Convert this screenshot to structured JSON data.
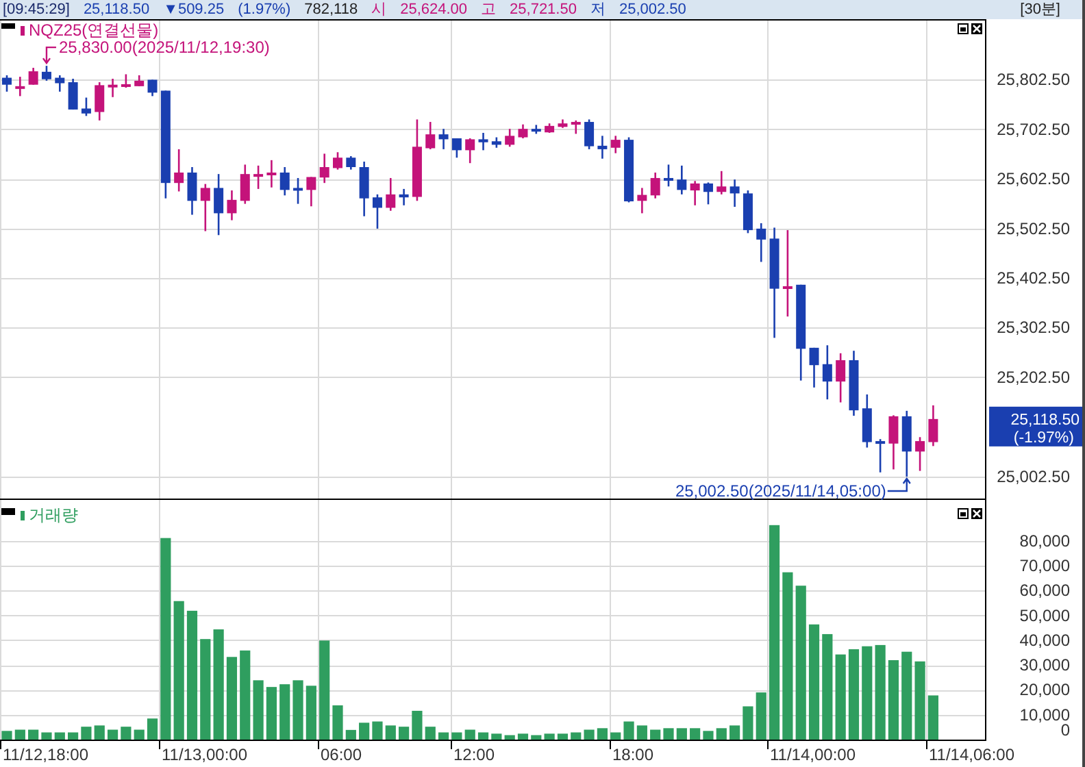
{
  "header": {
    "items": [
      {
        "text": "[09:45:29]",
        "kind": "time"
      },
      {
        "text": "25,118.50",
        "kind": "down"
      },
      {
        "text": "▼509.25",
        "kind": "down"
      },
      {
        "text": "(1.97%)",
        "kind": "down"
      },
      {
        "text": "782,118",
        "kind": "plain"
      },
      {
        "text": "시",
        "kind": "up"
      },
      {
        "text": "25,624.00",
        "kind": "up"
      },
      {
        "text": "고",
        "kind": "up"
      },
      {
        "text": "25,721.50",
        "kind": "up"
      },
      {
        "text": "저",
        "kind": "down"
      },
      {
        "text": "25,002.50",
        "kind": "down"
      }
    ],
    "interval": "[30분]"
  },
  "price_panel": {
    "legend": "NQZ25(연결선물)",
    "last_price": "25,118.50",
    "last_change": "(-1.97%)",
    "high_marker": "25,830.00(2025/11/12,19:30)",
    "low_marker": "25,002.50(2025/11/14,05:00)",
    "chart_data": {
      "type": "candlestick",
      "ylim": [
        24955.5,
        25924
      ],
      "yticks": [
        {
          "value": 25802.5,
          "label": "25,802.50"
        },
        {
          "value": 25702.5,
          "label": "25,702.50"
        },
        {
          "value": 25602.5,
          "label": "25,602.50"
        },
        {
          "value": 25502.5,
          "label": "25,502.50"
        },
        {
          "value": 25402.5,
          "label": "25,402.50"
        },
        {
          "value": 25302.5,
          "label": "25,302.50"
        },
        {
          "value": 25202.5,
          "label": "25,202.50"
        },
        {
          "value": 25002.5,
          "label": "25,002.50"
        }
      ],
      "grid": true,
      "ohlc": [
        [
          25806,
          25811,
          25778,
          25792
        ],
        [
          25786,
          25808,
          25769,
          25789
        ],
        [
          25792,
          25826,
          25792,
          25819
        ],
        [
          25818,
          25830,
          25800,
          25803
        ],
        [
          25806,
          25811,
          25778,
          25795
        ],
        [
          25797,
          25804,
          25742,
          25742
        ],
        [
          25744,
          25766,
          25729,
          25734
        ],
        [
          25737,
          25797,
          25720,
          25791
        ],
        [
          25791,
          25804,
          25767,
          25792
        ],
        [
          25789,
          25813,
          25786,
          25793
        ],
        [
          25789,
          25811,
          25789,
          25800
        ],
        [
          25802,
          25802,
          25769,
          25776
        ],
        [
          25780,
          25780,
          25563,
          25594
        ],
        [
          25594,
          25662,
          25577,
          25615
        ],
        [
          25615,
          25626,
          25530,
          25558
        ],
        [
          25558,
          25592,
          25497,
          25584
        ],
        [
          25584,
          25612,
          25489,
          25533
        ],
        [
          25533,
          25579,
          25519,
          25560
        ],
        [
          25558,
          25631,
          25552,
          25612
        ],
        [
          25611,
          25629,
          25582,
          25612
        ],
        [
          25610,
          25640,
          25585,
          25615
        ],
        [
          25615,
          25626,
          25569,
          25580
        ],
        [
          25584,
          25604,
          25552,
          25580
        ],
        [
          25580,
          25606,
          25547,
          25606
        ],
        [
          25605,
          25653,
          25594,
          25626
        ],
        [
          25624,
          25656,
          25621,
          25645
        ],
        [
          25645,
          25648,
          25621,
          25626
        ],
        [
          25626,
          25637,
          25527,
          25563
        ],
        [
          25565,
          25571,
          25502,
          25544
        ],
        [
          25544,
          25604,
          25538,
          25571
        ],
        [
          25571,
          25582,
          25549,
          25565
        ],
        [
          25566,
          25722,
          25558,
          25667
        ],
        [
          25664,
          25717,
          25662,
          25692
        ],
        [
          25692,
          25703,
          25662,
          25682
        ],
        [
          25684,
          25684,
          25645,
          25660
        ],
        [
          25660,
          25684,
          25634,
          25682
        ],
        [
          25682,
          25695,
          25660,
          25676
        ],
        [
          25678,
          25686,
          25665,
          25671
        ],
        [
          25671,
          25703,
          25667,
          25689
        ],
        [
          25686,
          25712,
          25684,
          25703
        ],
        [
          25703,
          25711,
          25693,
          25698
        ],
        [
          25696,
          25714,
          25695,
          25709
        ],
        [
          25707,
          25722,
          25705,
          25714
        ],
        [
          25712,
          25720,
          25693,
          25717
        ],
        [
          25717,
          25722,
          25662,
          25668
        ],
        [
          25669,
          25689,
          25643,
          25662
        ],
        [
          25665,
          25689,
          25654,
          25681
        ],
        [
          25681,
          25686,
          25555,
          25557
        ],
        [
          25558,
          25584,
          25533,
          25570
        ],
        [
          25569,
          25615,
          25563,
          25604
        ],
        [
          25604,
          25631,
          25587,
          25599
        ],
        [
          25601,
          25629,
          25571,
          25580
        ],
        [
          25579,
          25598,
          25549,
          25593
        ],
        [
          25593,
          25595,
          25551,
          25576
        ],
        [
          25576,
          25618,
          25571,
          25587
        ],
        [
          25587,
          25601,
          25546,
          25573
        ],
        [
          25573,
          25579,
          25493,
          25499
        ],
        [
          25502,
          25513,
          25435,
          25480
        ],
        [
          25482,
          25504,
          25282,
          25381
        ],
        [
          25385,
          25499,
          25325,
          25386
        ],
        [
          25389,
          25389,
          25196,
          25260
        ],
        [
          25262,
          25262,
          25182,
          25227
        ],
        [
          25229,
          25267,
          25158,
          25194
        ],
        [
          25194,
          25251,
          25152,
          25237
        ],
        [
          25237,
          25256,
          25125,
          25136
        ],
        [
          25140,
          25168,
          25061,
          25072
        ],
        [
          25074,
          25078,
          25011,
          25069
        ],
        [
          25069,
          25126,
          25017,
          25124
        ],
        [
          25124,
          25135,
          25002.5,
          25053
        ],
        [
          25053,
          25082,
          25014,
          25074
        ],
        [
          25072,
          25146,
          25064,
          25118.5
        ]
      ]
    }
  },
  "time_axis_labels": [
    "11/12,18:00",
    "11/13,00:00",
    "06:00",
    "12:00",
    "18:00",
    "11/14,00:00",
    "11/14,06:00"
  ],
  "volume_panel": {
    "legend": "거래량",
    "chart_data": {
      "type": "bar",
      "grid": true,
      "ylim": [
        0,
        96550
      ],
      "yticks": [
        {
          "value": 80000,
          "label": "80,000"
        },
        {
          "value": 70000,
          "label": "70,000"
        },
        {
          "value": 60000,
          "label": "60,000"
        },
        {
          "value": 50000,
          "label": "50,000"
        },
        {
          "value": 40000,
          "label": "40,000"
        },
        {
          "value": 30000,
          "label": "30,000"
        },
        {
          "value": 20000,
          "label": "20,000"
        },
        {
          "value": 10000,
          "label": "10,000"
        },
        {
          "value": 0,
          "label": "0"
        }
      ],
      "values": [
        3500,
        4000,
        4000,
        2900,
        2900,
        2900,
        5200,
        5700,
        4000,
        5200,
        4000,
        8500,
        81200,
        55800,
        51900,
        40500,
        44400,
        33300,
        35900,
        23900,
        21200,
        22300,
        23900,
        21700,
        39900,
        13800,
        3900,
        6800,
        7300,
        5700,
        5200,
        11600,
        5200,
        2900,
        2900,
        4000,
        2900,
        2400,
        1800,
        2400,
        1800,
        2400,
        2400,
        2900,
        4000,
        4600,
        2900,
        7300,
        5700,
        4000,
        4600,
        4600,
        4600,
        3500,
        4600,
        5700,
        13400,
        19000,
        86400,
        67400,
        62000,
        46400,
        42500,
        34300,
        36400,
        37600,
        38100,
        32000,
        35400,
        31500,
        17800
      ]
    }
  }
}
